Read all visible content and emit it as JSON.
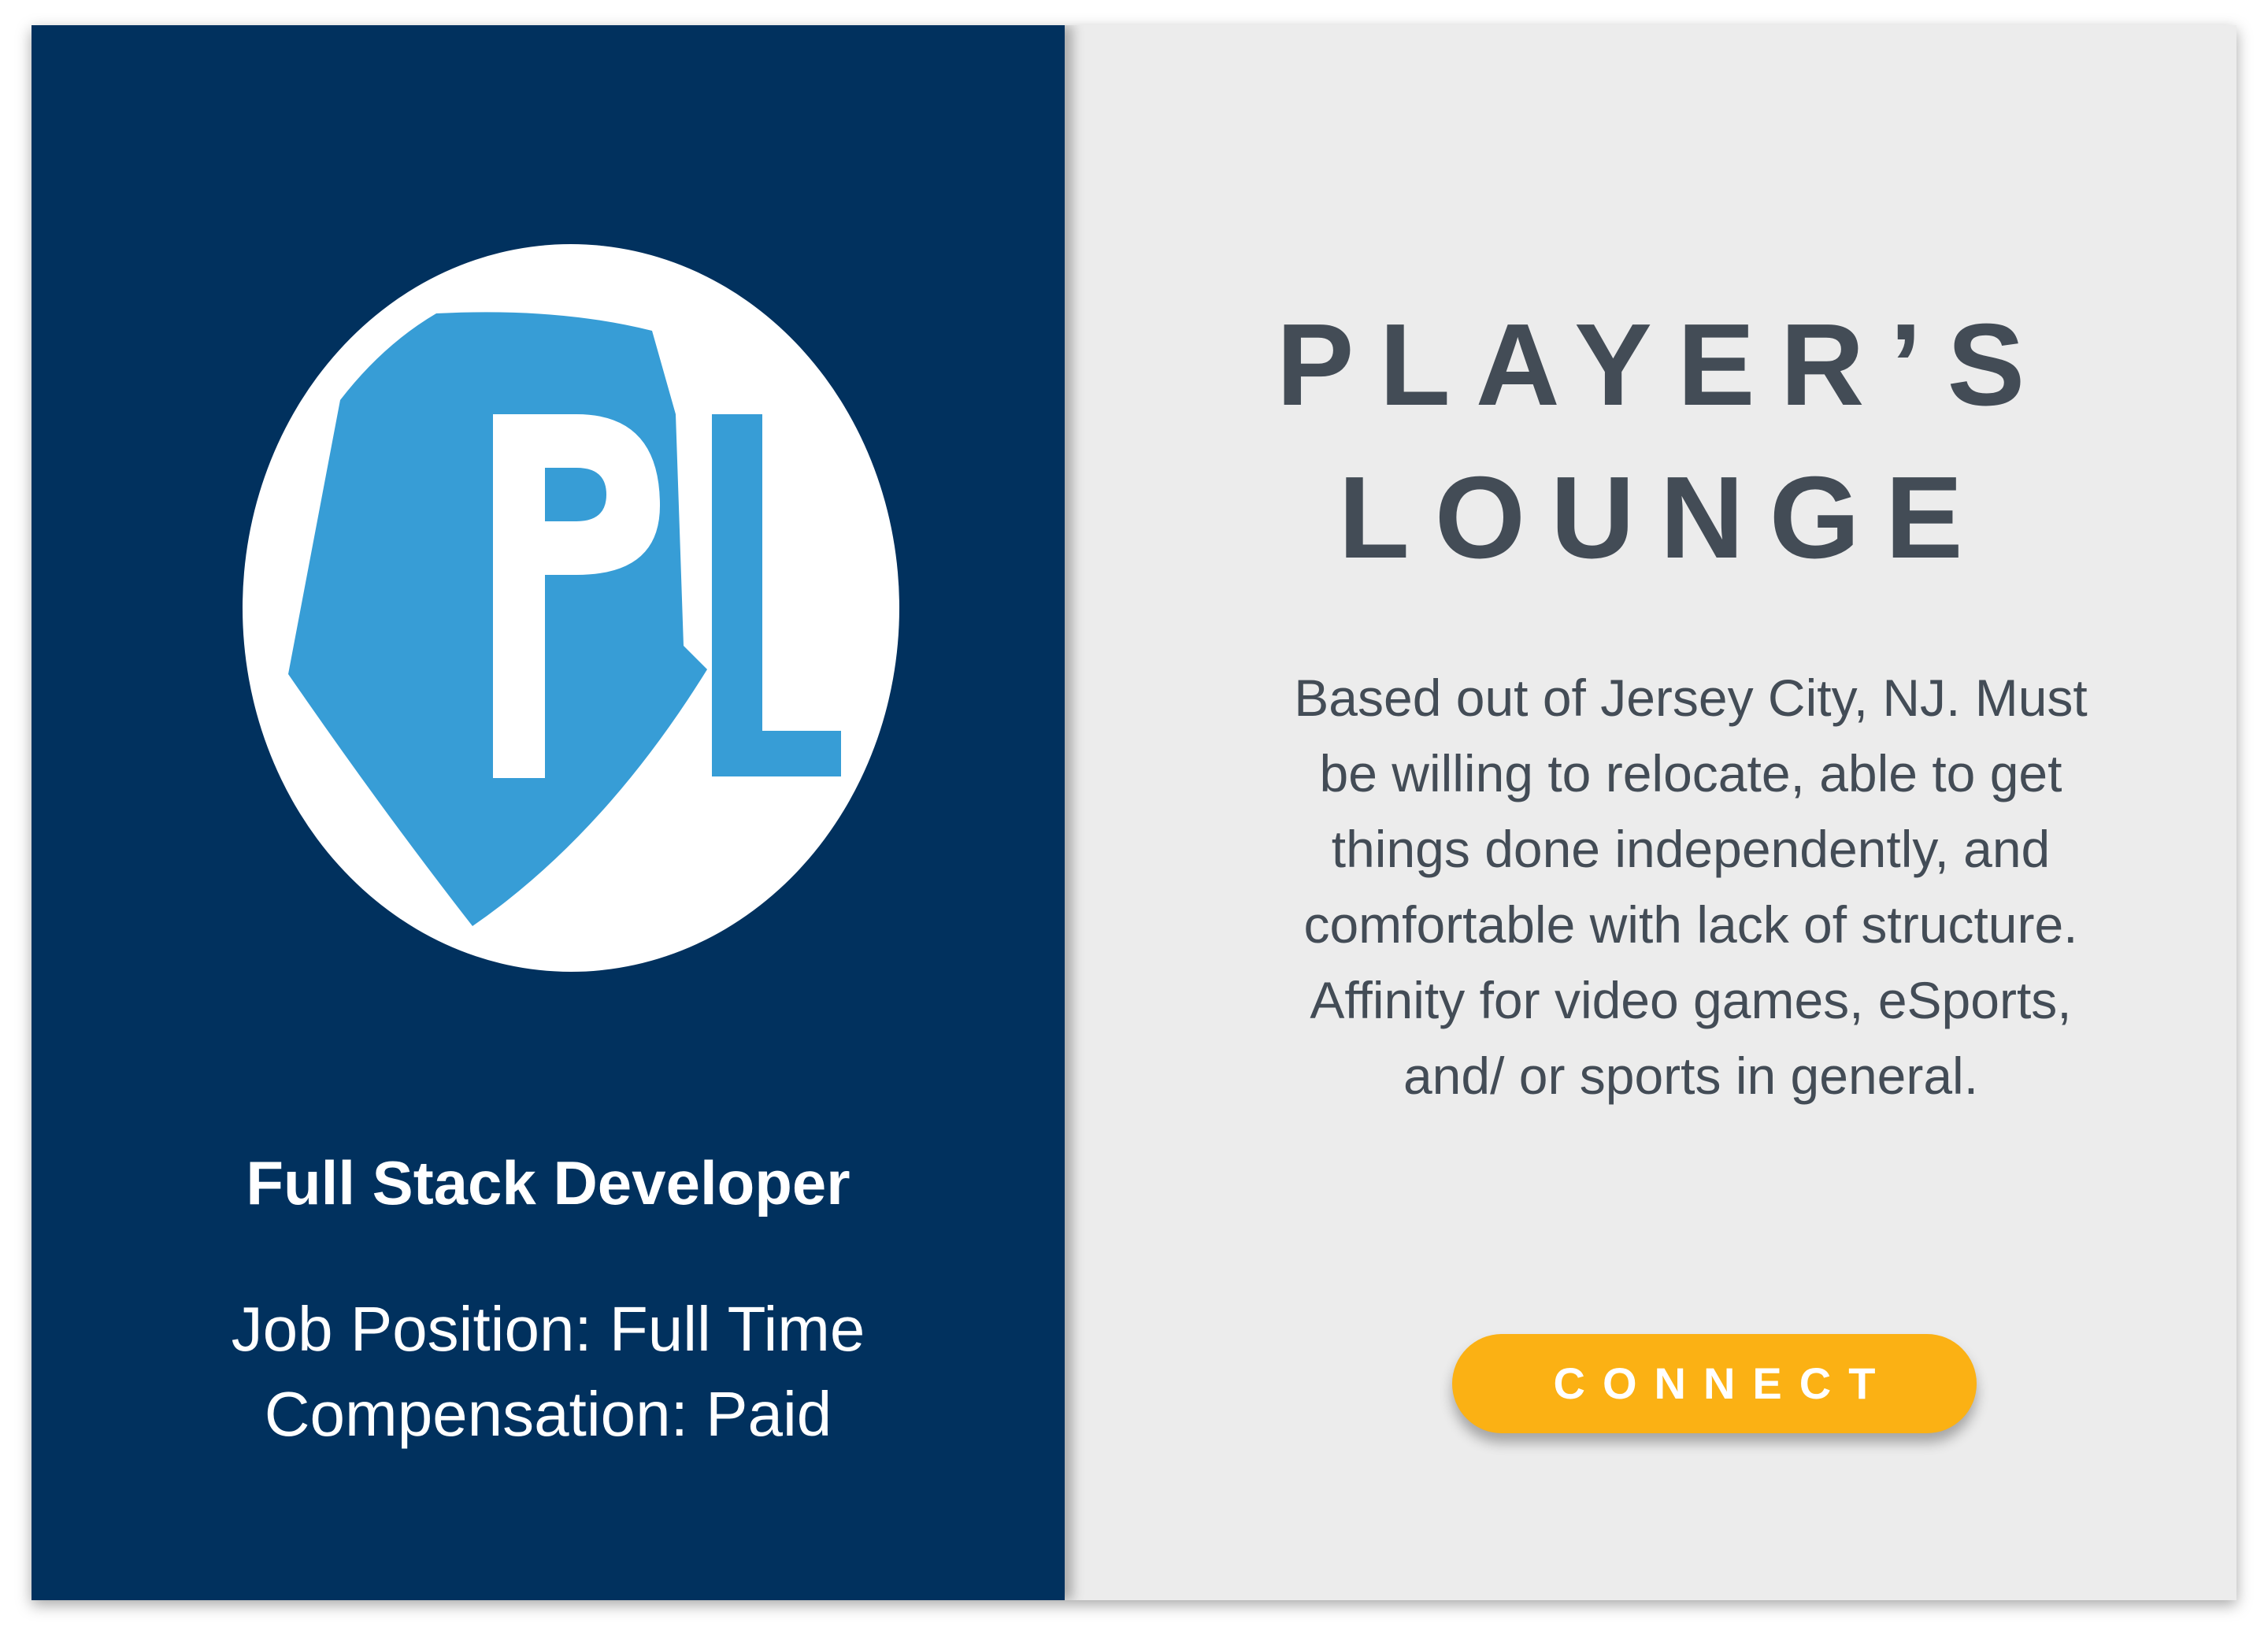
{
  "company": {
    "name_line1": "PLAYER’S",
    "name_line2": "LOUNGE",
    "logo_text": "PL",
    "description": "Based out of Jersey City, NJ. Must be willing to relocate, able to get things done independently, and comfortable with lack of structure. Affinity for video games, eSports, and/ or sports in general."
  },
  "job": {
    "title": "Full Stack Developer",
    "position": "Job Position: Full Time",
    "compensation": "Compensation: Paid"
  },
  "actions": {
    "connect_label": "CONNECT"
  },
  "colors": {
    "left_panel": "#01315e",
    "right_panel": "#ececec",
    "logo_blue": "#379dd6",
    "heading_text": "#434c56",
    "button": "#fbb114"
  },
  "icons": {
    "logo": "players-lounge-logo-icon"
  }
}
